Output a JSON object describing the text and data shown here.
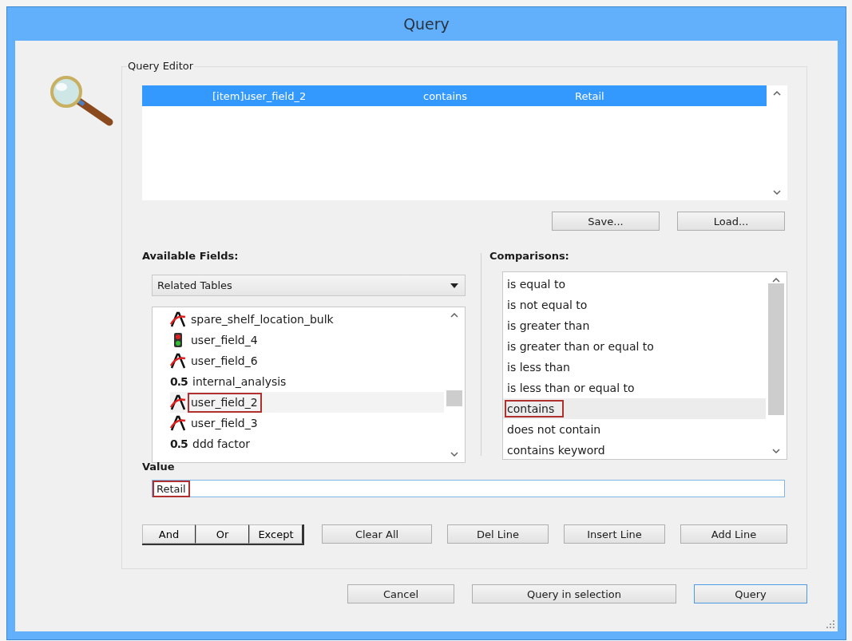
{
  "window": {
    "title": "Query"
  },
  "query_editor": {
    "title": "Query Editor",
    "rows": [
      {
        "field": "[item]user_field_2",
        "comparison": "contains",
        "value": "Retail",
        "selected": true
      }
    ],
    "buttons": [
      "Save...",
      "Load..."
    ]
  },
  "available_fields": {
    "label": "Available Fields:",
    "dropdown": "Related Tables",
    "items": [
      {
        "kind": "text",
        "name": "spare_shelf_location_bulk",
        "selected": false,
        "highlighted": false
      },
      {
        "kind": "flag",
        "name": "user_field_4",
        "selected": false,
        "highlighted": false
      },
      {
        "kind": "text",
        "name": "user_field_6",
        "selected": false,
        "highlighted": false
      },
      {
        "kind": "number",
        "icon_text": "0.5",
        "name": "internal_analysis",
        "selected": false,
        "highlighted": false
      },
      {
        "kind": "text",
        "name": "user_field_2",
        "selected": true,
        "highlighted": true
      },
      {
        "kind": "text",
        "name": "user_field_3",
        "selected": false,
        "highlighted": false
      },
      {
        "kind": "number",
        "icon_text": "0.5",
        "name": "ddd factor",
        "selected": false,
        "highlighted": false
      }
    ]
  },
  "comparisons": {
    "label": "Comparisons:",
    "items": [
      {
        "text": "is equal to",
        "selected": false,
        "highlighted": false
      },
      {
        "text": "is not equal to",
        "selected": false,
        "highlighted": false
      },
      {
        "text": "is greater than",
        "selected": false,
        "highlighted": false
      },
      {
        "text": "is greater than or equal to",
        "selected": false,
        "highlighted": false
      },
      {
        "text": "is less than",
        "selected": false,
        "highlighted": false
      },
      {
        "text": "is less than or equal to",
        "selected": false,
        "highlighted": false
      },
      {
        "text": "contains",
        "selected": true,
        "highlighted": true
      },
      {
        "text": "does not contain",
        "selected": false,
        "highlighted": false
      },
      {
        "text": "contains keyword",
        "selected": false,
        "highlighted": false
      }
    ]
  },
  "value": {
    "label": "Value",
    "text": "Retail",
    "highlighted": true
  },
  "operators": [
    "And",
    "Or",
    "Except"
  ],
  "line_buttons": [
    "Clear All",
    "Del Line",
    "Insert Line",
    "Add Line"
  ],
  "dialog_buttons": [
    {
      "label": "Cancel",
      "default": false
    },
    {
      "label": "Query in selection",
      "default": false
    },
    {
      "label": "Query",
      "default": true
    }
  ]
}
